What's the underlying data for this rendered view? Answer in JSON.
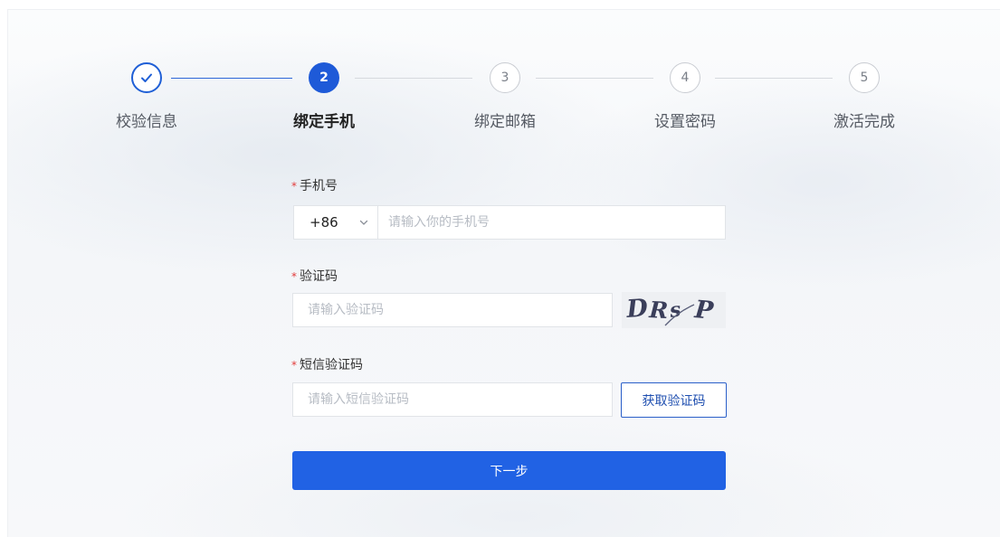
{
  "steps": [
    {
      "number": "1",
      "label": "校验信息",
      "state": "done"
    },
    {
      "number": "2",
      "label": "绑定手机",
      "state": "active"
    },
    {
      "number": "3",
      "label": "绑定邮箱",
      "state": "pending"
    },
    {
      "number": "4",
      "label": "设置密码",
      "state": "pending"
    },
    {
      "number": "5",
      "label": "激活完成",
      "state": "pending"
    }
  ],
  "form": {
    "required_mark": "*",
    "phone": {
      "label": "手机号",
      "country_code": "+86",
      "placeholder": "请输入你的手机号"
    },
    "captcha": {
      "label": "验证码",
      "placeholder": "请输入验证码",
      "image_text": "DRsP"
    },
    "sms_code": {
      "label": "短信验证码",
      "placeholder": "请输入短信验证码",
      "send_button": "获取验证码"
    },
    "next_button": "下一步"
  },
  "colors": {
    "primary": "#2162e4",
    "required": "#e23b3b"
  }
}
